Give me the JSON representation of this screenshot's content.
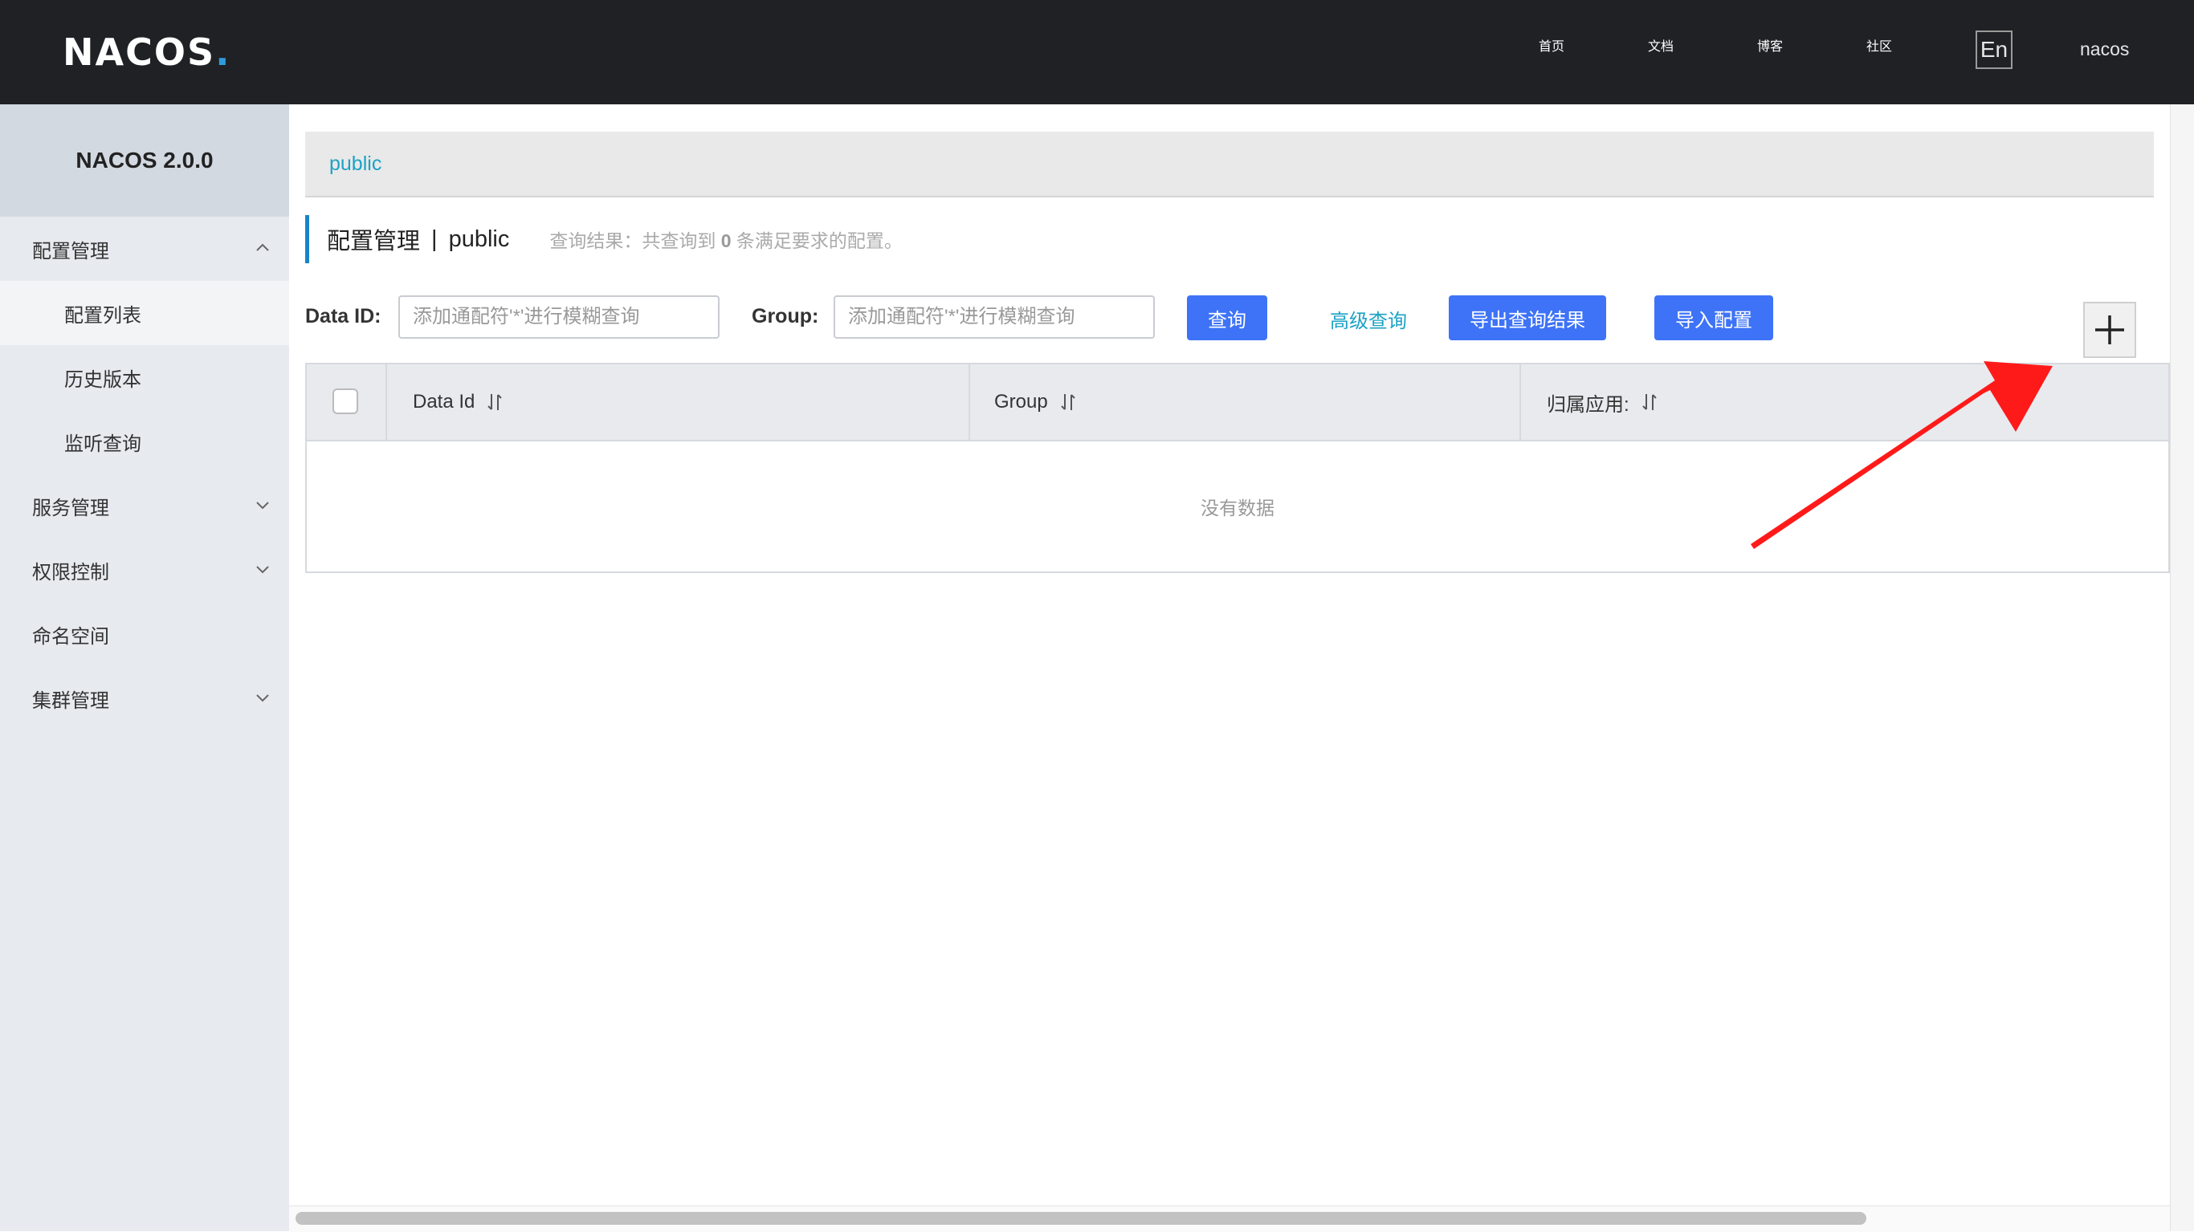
{
  "header": {
    "logo_text": "NACOS",
    "logo_dot": ".",
    "nav": [
      "首页",
      "文档",
      "博客",
      "社区"
    ],
    "lang": "En",
    "user": "nacos"
  },
  "sidebar": {
    "version": "NACOS 2.0.0",
    "items": [
      {
        "label": "配置管理",
        "expanded": true
      },
      {
        "label": "配置列表"
      },
      {
        "label": "历史版本"
      },
      {
        "label": "监听查询"
      },
      {
        "label": "服务管理"
      },
      {
        "label": "权限控制"
      },
      {
        "label": "命名空间"
      },
      {
        "label": "集群管理"
      }
    ]
  },
  "namespace_bar": {
    "current": "public"
  },
  "page": {
    "title": "配置管理",
    "separator": "|",
    "namespace": "public",
    "result_prefix": "查询结果：共查询到",
    "result_count": "0",
    "result_suffix": "条满足要求的配置。"
  },
  "search": {
    "dataid_label": "Data ID:",
    "dataid_placeholder": "添加通配符'*'进行模糊查询",
    "group_label": "Group:",
    "group_placeholder": "添加通配符'*'进行模糊查询",
    "query_button": "查询",
    "advanced_link": "高级查询",
    "export_button": "导出查询结果",
    "import_button": "导入配置"
  },
  "table": {
    "columns": [
      "Data Id",
      "Group",
      "归属应用:"
    ],
    "empty_text": "没有数据"
  },
  "colors": {
    "accent_blue": "#3e73f7",
    "link": "#1ca2c5",
    "arrow": "#ff1a1a"
  }
}
